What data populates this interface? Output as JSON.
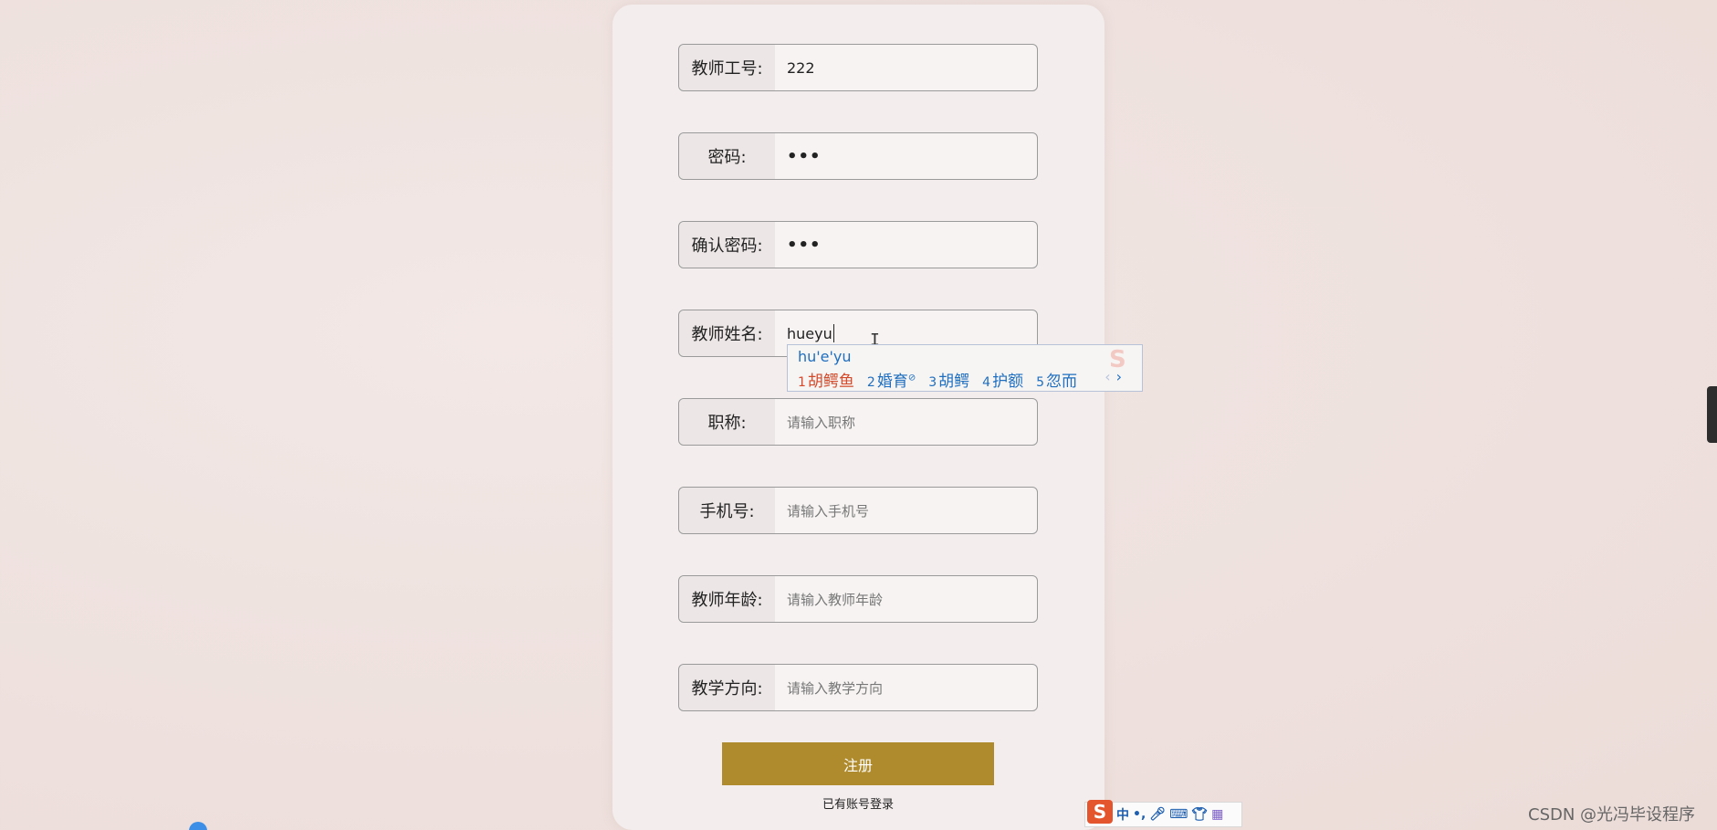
{
  "form": {
    "fields": [
      {
        "label": "教师工号:",
        "value": "222",
        "placeholder": ""
      },
      {
        "label": "密码:",
        "value": "•••",
        "placeholder": ""
      },
      {
        "label": "确认密码:",
        "value": "•••",
        "placeholder": ""
      },
      {
        "label": "教师姓名:",
        "value": "hueyu",
        "placeholder": ""
      },
      {
        "label": "职称:",
        "value": "",
        "placeholder": "请输入职称"
      },
      {
        "label": "手机号:",
        "value": "",
        "placeholder": "请输入手机号"
      },
      {
        "label": "教师年龄:",
        "value": "",
        "placeholder": "请输入教师年龄"
      },
      {
        "label": "教学方向:",
        "value": "",
        "placeholder": "请输入教学方向"
      }
    ],
    "submit_label": "注册",
    "login_link": "已有账号登录"
  },
  "ime_popup": {
    "pinyin": "hu'e'yu",
    "candidates": [
      {
        "num": "1",
        "text": "胡鳄鱼"
      },
      {
        "num": "2",
        "text": "婚育"
      },
      {
        "num": "3",
        "text": "胡鳄"
      },
      {
        "num": "4",
        "text": "护额"
      },
      {
        "num": "5",
        "text": "忽而"
      }
    ],
    "prev": "‹",
    "next": "›"
  },
  "ime_toolbar": {
    "logo": "S",
    "mode": "中",
    "punct": "•,",
    "items": [
      "mic-icon",
      "keyboard-icon",
      "skin-icon",
      "toolbox-icon"
    ]
  },
  "watermark": "CSDN @光冯毕设程序",
  "colors": {
    "accent": "#b08b2e",
    "candidate_active": "#d24a2a",
    "candidate": "#1e6fbf"
  }
}
